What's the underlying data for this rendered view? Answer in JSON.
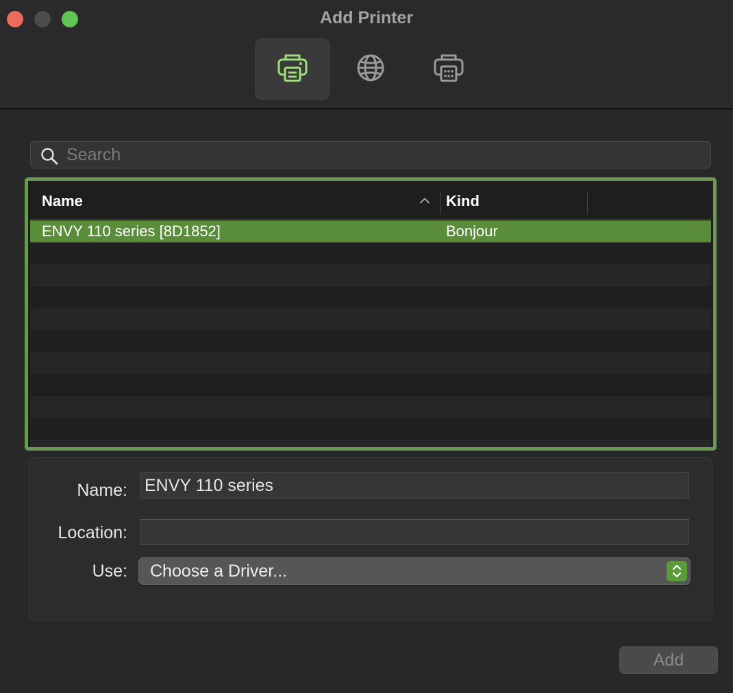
{
  "window": {
    "title": "Add Printer"
  },
  "toolbar": {
    "items": [
      {
        "icon": "printer-default-icon",
        "active": true
      },
      {
        "icon": "globe-ip-icon",
        "active": false
      },
      {
        "icon": "printer-windows-icon",
        "active": false
      }
    ]
  },
  "search": {
    "placeholder": "Search",
    "value": ""
  },
  "table": {
    "columns": [
      "Name",
      "Kind"
    ],
    "sort_column": "Name",
    "sort_direction": "ascending",
    "rows": [
      {
        "name": "ENVY 110 series [8D1852]",
        "kind": "Bonjour",
        "selected": true
      }
    ]
  },
  "form": {
    "name_label": "Name:",
    "name_value": "ENVY 110 series",
    "location_label": "Location:",
    "location_value": "",
    "use_label": "Use:",
    "use_value": "Choose a Driver..."
  },
  "footer": {
    "add_label": "Add",
    "add_enabled": false
  },
  "colors": {
    "accent": "#5a8d3a",
    "focus_ring": "#6a9a52",
    "toolbar_icon_active": "#9ee07a"
  }
}
